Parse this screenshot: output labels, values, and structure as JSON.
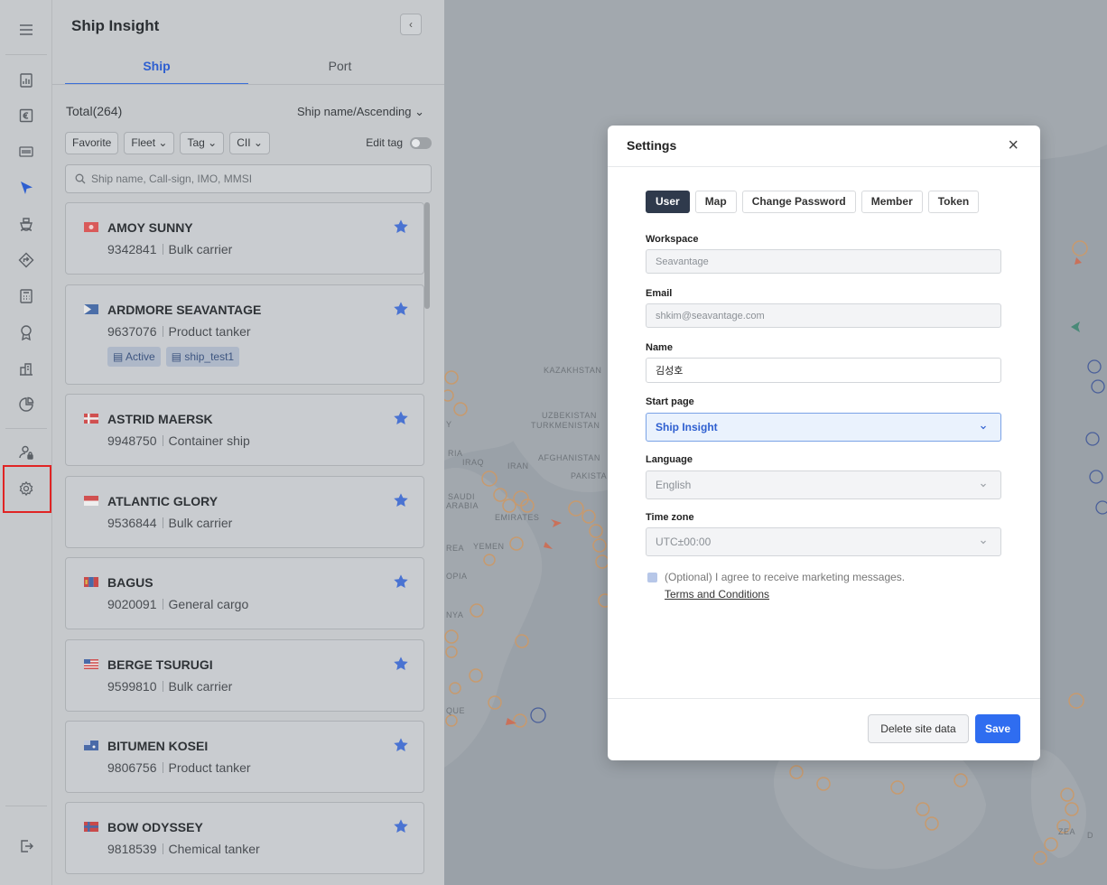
{
  "rail": {
    "icons": [
      "menu-icon",
      "report-icon",
      "euro-icon",
      "barcode-icon",
      "navigation-icon",
      "ship-icon",
      "route-icon",
      "calculator-icon",
      "award-icon",
      "cargo-icon",
      "pie-chart-icon",
      "user-lock-icon",
      "settings-icon",
      "logout-icon"
    ],
    "active": "navigation-icon",
    "highlighted": "settings-icon"
  },
  "panel": {
    "title": "Ship Insight",
    "tabs": [
      "Ship",
      "Port"
    ],
    "active_tab": "Ship",
    "total": "Total(264)",
    "sort": "Ship name/Ascending",
    "filters": [
      "Favorite",
      "Fleet",
      "Tag",
      "CII"
    ],
    "edit_tag": "Edit tag",
    "search_placeholder": "Ship name, Call-sign, IMO, MMSI",
    "ships": [
      {
        "name": "AMOY SUNNY",
        "imo": "9342841",
        "type": "Bulk carrier",
        "tags": []
      },
      {
        "name": "ARDMORE SEAVANTAGE",
        "imo": "9637076",
        "type": "Product tanker",
        "tags": [
          "Active",
          "ship_test1"
        ]
      },
      {
        "name": "ASTRID MAERSK",
        "imo": "9948750",
        "type": "Container ship",
        "tags": []
      },
      {
        "name": "ATLANTIC GLORY",
        "imo": "9536844",
        "type": "Bulk carrier",
        "tags": []
      },
      {
        "name": "BAGUS",
        "imo": "9020091",
        "type": "General cargo",
        "tags": []
      },
      {
        "name": "BERGE TSURUGI",
        "imo": "9599810",
        "type": "Bulk carrier",
        "tags": []
      },
      {
        "name": "BITUMEN KOSEI",
        "imo": "9806756",
        "type": "Product tanker",
        "tags": []
      },
      {
        "name": "BOW ODYSSEY",
        "imo": "9818539",
        "type": "Chemical tanker",
        "tags": []
      }
    ]
  },
  "map": {
    "labels": [
      "KAZAKHSTAN",
      "UZBEKISTAN",
      "TURKMENISTAN",
      "IRAQ",
      "IRAN",
      "AFGHANISTAN",
      "PAKISTA",
      "SAUDI",
      "ARABIA",
      "EMIRATES",
      "YEMEN",
      "REA",
      "OPIA",
      "NYA",
      "QUE",
      "RIA",
      "Y",
      "ZEA",
      "D"
    ]
  },
  "settings": {
    "title": "Settings",
    "close": "×",
    "tabs": [
      "User",
      "Map",
      "Change Password",
      "Member",
      "Token"
    ],
    "active_tab": "User",
    "workspace_label": "Workspace",
    "workspace_value": "Seavantage",
    "email_label": "Email",
    "email_value": "shkim@seavantage.com",
    "name_label": "Name",
    "name_value": "김성호",
    "start_page_label": "Start page",
    "start_page_value": "Ship Insight",
    "language_label": "Language",
    "language_value": "English",
    "timezone_label": "Time zone",
    "timezone_value": "UTC±00:00",
    "consent_text": "(Optional) I agree to receive marketing messages.",
    "terms_link": "Terms and Conditions",
    "delete_button": "Delete site data",
    "save_button": "Save"
  }
}
